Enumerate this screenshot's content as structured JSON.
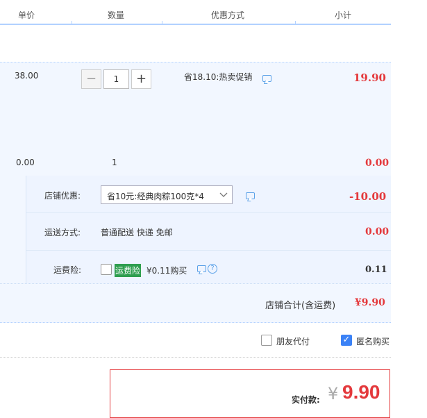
{
  "header": {
    "col_unit_price": "单价",
    "col_quantity": "数量",
    "col_promo": "优惠方式",
    "col_subtotal": "小计"
  },
  "item": {
    "unit_price": "38.00",
    "quantity_value": "1",
    "promo_text": "省18.10:热卖促销",
    "subtotal": "19.90"
  },
  "gift_item": {
    "unit_price": "0.00",
    "quantity": "1",
    "subtotal": "0.00"
  },
  "shop": {
    "discount_label": "店铺优惠:",
    "discount_selected": "省10元:经典肉粽100克*4",
    "discount_amount": "-10.00",
    "shipping_label": "运送方式:",
    "shipping_value": "普通配送 快递 免邮",
    "shipping_amount": "0.00",
    "insurance_label": "运费险:",
    "insurance_tag": "运费险",
    "insurance_price": "¥0.11购买",
    "insurance_amount": "0.11",
    "total_label": "店铺合计(含运费)",
    "total_amount": "¥9.90"
  },
  "options": {
    "friend_pay_label": "朋友代付",
    "friend_pay_checked": false,
    "anonymous_label": "匿名购买",
    "anonymous_checked": true
  },
  "payment": {
    "label": "实付款:",
    "currency": "¥",
    "amount": "9.90"
  },
  "colors": {
    "accent_red": "#e4393c",
    "header_border": "#b2d1ff",
    "panel_bg": "#f2f7ff",
    "tag_green": "#2e9e4f",
    "checkbox_blue": "#3b82f6"
  }
}
